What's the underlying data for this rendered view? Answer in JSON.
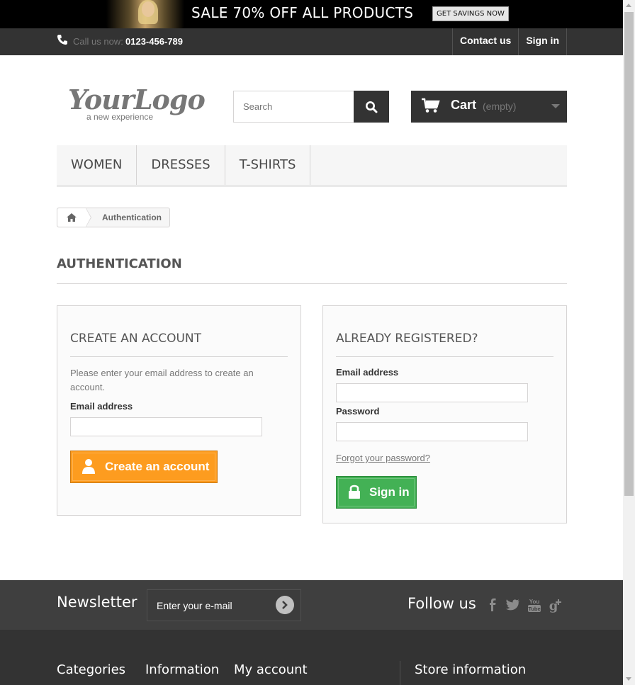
{
  "banner": {
    "text": "SALE 70% OFF ALL PRODUCTS",
    "button_label": "GET SAVINGS NOW"
  },
  "topbar": {
    "call_label": "Call us now:",
    "phone": "0123-456-789",
    "links": [
      "Contact us",
      "Sign in"
    ]
  },
  "header": {
    "logo_main": "YourLogo",
    "logo_sub": "a new experience",
    "search_placeholder": "Search",
    "cart_label": "Cart",
    "cart_qty": "(empty)"
  },
  "menu": {
    "items": [
      "WOMEN",
      "DRESSES",
      "T-SHIRTS"
    ]
  },
  "breadcrumb": {
    "current": "Authentication"
  },
  "page": {
    "heading": "AUTHENTICATION"
  },
  "create_account": {
    "title": "CREATE AN ACCOUNT",
    "description": "Please enter your email address to create an account.",
    "email_label": "Email address",
    "email_value": "",
    "button_label": "Create an account"
  },
  "login": {
    "title": "ALREADY REGISTERED?",
    "email_label": "Email address",
    "email_value": "",
    "password_label": "Password",
    "password_value": "",
    "forgot_label": "Forgot your password?",
    "button_label": "Sign in"
  },
  "footer": {
    "newsletter_title": "Newsletter",
    "newsletter_placeholder": "Enter your e-mail",
    "follow_title": "Follow us",
    "social": [
      "facebook-icon",
      "twitter-icon",
      "youtube-icon",
      "google-plus-icon"
    ],
    "columns": [
      "Categories",
      "Information",
      "My account",
      "Store information"
    ]
  },
  "colors": {
    "dark": "#333333",
    "create_button": "#fd9c1f",
    "signin_button": "#43b155"
  }
}
